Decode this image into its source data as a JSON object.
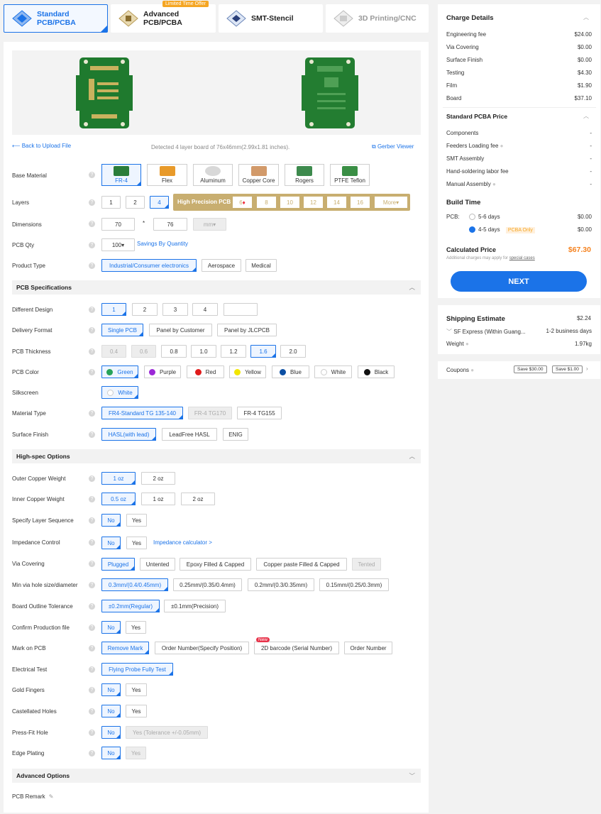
{
  "tabs": [
    {
      "label": "Standard PCB/PCBA"
    },
    {
      "label": "Advanced PCB/PCBA",
      "badge": "Limited Time Offer"
    },
    {
      "label": "SMT-Stencil"
    },
    {
      "label": "3D Printing/CNC"
    }
  ],
  "upload": {
    "back": "Back to Upload File",
    "detected": "Detected 4 layer board of 76x46mm(2.99x1.81 inches).",
    "gerber": "Gerber Viewer"
  },
  "labels": {
    "base_material": "Base Material",
    "layers": "Layers",
    "dimensions": "Dimensions",
    "pcb_qty": "PCB Qty",
    "product_type": "Product Type",
    "different_design": "Different Design",
    "delivery_format": "Delivery Format",
    "pcb_thickness": "PCB Thickness",
    "pcb_color": "PCB Color",
    "silkscreen": "Silkscreen",
    "material_type": "Material Type",
    "surface_finish": "Surface Finish",
    "outer_copper": "Outer Copper Weight",
    "inner_copper": "Inner Copper Weight",
    "layer_seq": "Specify Layer Sequence",
    "impedance": "Impedance Control",
    "via_covering": "Via Covering",
    "min_via": "Min via hole size/diameter",
    "outline_tol": "Board Outline Tolerance",
    "confirm_file": "Confirm Production file",
    "mark_pcb": "Mark on PCB",
    "electrical_test": "Electrical Test",
    "gold_fingers": "Gold Fingers",
    "castellated": "Castellated Holes",
    "pressfit": "Press-Fit Hole",
    "edge_plating": "Edge Plating",
    "pcb_remark": "PCB Remark"
  },
  "materials": [
    "FR-4",
    "Flex",
    "Aluminum",
    "Copper Core",
    "Rogers",
    "PTFE Teflon"
  ],
  "layers": [
    "1",
    "2",
    "4"
  ],
  "high_precision": {
    "label": "High Precision PCB",
    "options": [
      "6",
      "8",
      "10",
      "12",
      "14",
      "16"
    ],
    "more": "More"
  },
  "dimensions": {
    "w": "70",
    "x": "*",
    "h": "76",
    "unit": "mm"
  },
  "qty": {
    "value": "100",
    "savings": "Savings By Quantity"
  },
  "product_types": [
    "Industrial/Consumer electronics",
    "Aerospace",
    "Medical"
  ],
  "sections": {
    "specs": "PCB Specifications",
    "highspec": "High-spec Options",
    "advanced": "Advanced Options"
  },
  "designs": [
    "1",
    "2",
    "3",
    "4",
    ""
  ],
  "delivery": [
    "Single PCB",
    "Panel by Customer",
    "Panel by JLCPCB"
  ],
  "thickness": [
    "0.4",
    "0.6",
    "0.8",
    "1.0",
    "1.2",
    "1.6",
    "2.0"
  ],
  "colors": [
    {
      "name": "Green",
      "hex": "#27a35a"
    },
    {
      "name": "Purple",
      "hex": "#9b27d6"
    },
    {
      "name": "Red",
      "hex": "#e01b1b"
    },
    {
      "name": "Yellow",
      "hex": "#f2e600"
    },
    {
      "name": "Blue",
      "hex": "#0b4ea2"
    },
    {
      "name": "White",
      "hex": "#ffffff"
    },
    {
      "name": "Black",
      "hex": "#111111"
    }
  ],
  "silk": [
    "White"
  ],
  "material_types": [
    "FR4-Standard TG 135-140",
    "FR-4 TG170",
    "FR-4 TG155"
  ],
  "surface_finishes": [
    "HASL(with lead)",
    "LeadFree HASL",
    "ENIG"
  ],
  "outer_copper": [
    "1 oz",
    "2 oz"
  ],
  "inner_copper": [
    "0.5 oz",
    "1 oz",
    "2 oz"
  ],
  "noyes": [
    "No",
    "Yes"
  ],
  "impedance_link": "Impedance calculator >",
  "via_cov": [
    "Plugged",
    "Untented",
    "Epoxy Filled & Capped",
    "Copper paste Filled & Capped",
    "Tented"
  ],
  "min_via": [
    "0.3mm/(0.4/0.45mm)",
    "0.25mm/(0.35/0.4mm)",
    "0.2mm/(0.3/0.35mm)",
    "0.15mm/(0.25/0.3mm)"
  ],
  "outline": [
    "±0.2mm(Regular)",
    "±0.1mm(Precision)"
  ],
  "mark": [
    "Remove Mark",
    "Order Number(Specify Position)",
    "2D barcode (Serial Number)",
    "Order Number"
  ],
  "new_badge": "New",
  "etest": [
    "Flying Probe Fully Test"
  ],
  "pressfit_yes": "Yes (Tolerance +/-0.05mm)",
  "charge": {
    "title": "Charge Details",
    "rows": [
      [
        "Engineering fee",
        "$24.00"
      ],
      [
        "Via Covering",
        "$0.00"
      ],
      [
        "Surface Finish",
        "$0.00"
      ],
      [
        "Testing",
        "$4.30"
      ],
      [
        "Film",
        "$1.90"
      ],
      [
        "Board",
        "$37.10"
      ]
    ],
    "pcba_title": "Standard PCBA Price",
    "pcba_rows": [
      [
        "Components",
        "-"
      ],
      [
        "Feeders Loading fee",
        "-"
      ],
      [
        "SMT Assembly",
        "-"
      ],
      [
        "Hand-soldering labor fee",
        "-"
      ],
      [
        "Manual Assembly",
        "-"
      ]
    ],
    "build_title": "Build Time",
    "pcb_label": "PCB:",
    "build": [
      [
        "5-6 days",
        "$0.00"
      ],
      [
        "4-5 days",
        "$0.00"
      ]
    ],
    "pcba_only": "PCBA Only",
    "calc_label": "Calculated Price",
    "calc_value": "$67.30",
    "note": "Additional charges may apply for",
    "note_link": "special cases",
    "next": "NEXT"
  },
  "shipping": {
    "title": "Shipping Estimate",
    "price": "$2.24",
    "method": "SF Express (Within Guang...",
    "days": "1-2 business days",
    "weight_label": "Weight",
    "weight": "1.97kg"
  },
  "coupons": {
    "label": "Coupons",
    "c1": "Save $30.00",
    "c2": "Save $1.00"
  }
}
